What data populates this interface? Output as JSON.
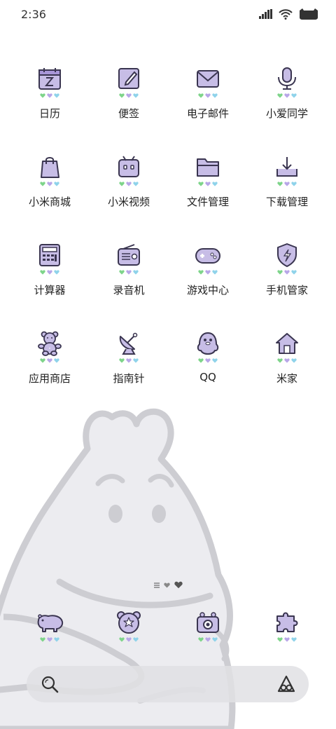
{
  "status_bar": {
    "time": "2:36",
    "icons": [
      "signal-icon",
      "wifi-icon",
      "battery-icon"
    ]
  },
  "theme": {
    "icon_fill": "#c7bde6",
    "icon_stroke": "#3a3550",
    "heart_green": "#7ed48a",
    "heart_purple": "#b8a6e8",
    "heart_blue": "#8fd3ea"
  },
  "apps": [
    {
      "label": "日历",
      "icon": "calendar-icon"
    },
    {
      "label": "便签",
      "icon": "notes-icon"
    },
    {
      "label": "电子邮件",
      "icon": "email-icon"
    },
    {
      "label": "小爱同学",
      "icon": "microphone-icon"
    },
    {
      "label": "小米商城",
      "icon": "shopping-bag-icon"
    },
    {
      "label": "小米视频",
      "icon": "tv-icon"
    },
    {
      "label": "文件管理",
      "icon": "folder-icon"
    },
    {
      "label": "下载管理",
      "icon": "download-icon"
    },
    {
      "label": "计算器",
      "icon": "calculator-icon"
    },
    {
      "label": "录音机",
      "icon": "radio-icon"
    },
    {
      "label": "游戏中心",
      "icon": "gamepad-icon"
    },
    {
      "label": "手机管家",
      "icon": "shield-icon"
    },
    {
      "label": "应用商店",
      "icon": "teddy-bear-icon"
    },
    {
      "label": "指南针",
      "icon": "satellite-dish-icon"
    },
    {
      "label": "QQ",
      "icon": "penguin-icon"
    },
    {
      "label": "米家",
      "icon": "house-icon"
    }
  ],
  "dock": [
    {
      "icon": "hippo-icon"
    },
    {
      "icon": "bear-face-icon"
    },
    {
      "icon": "camera-icon"
    },
    {
      "icon": "puzzle-icon"
    }
  ],
  "search": {
    "left_icon": "search-icon",
    "right_icon": "assistant-icon"
  }
}
